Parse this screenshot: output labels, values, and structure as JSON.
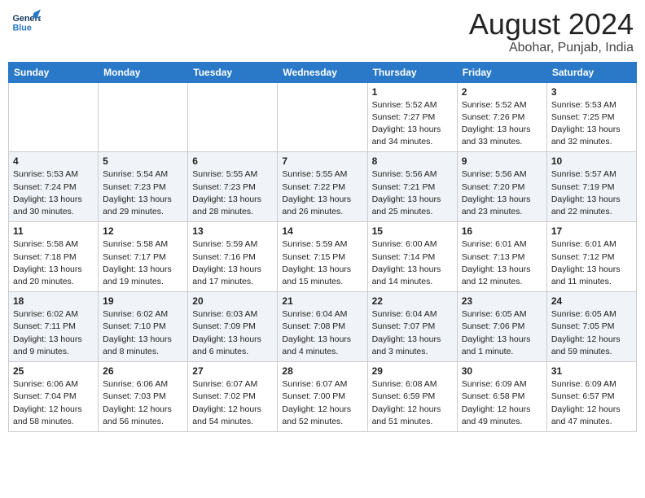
{
  "header": {
    "logo_line1": "General",
    "logo_line2": "Blue",
    "month": "August 2024",
    "location": "Abohar, Punjab, India"
  },
  "days_of_week": [
    "Sunday",
    "Monday",
    "Tuesday",
    "Wednesday",
    "Thursday",
    "Friday",
    "Saturday"
  ],
  "weeks": [
    [
      {
        "day": "",
        "info": ""
      },
      {
        "day": "",
        "info": ""
      },
      {
        "day": "",
        "info": ""
      },
      {
        "day": "",
        "info": ""
      },
      {
        "day": "1",
        "info": "Sunrise: 5:52 AM\nSunset: 7:27 PM\nDaylight: 13 hours\nand 34 minutes."
      },
      {
        "day": "2",
        "info": "Sunrise: 5:52 AM\nSunset: 7:26 PM\nDaylight: 13 hours\nand 33 minutes."
      },
      {
        "day": "3",
        "info": "Sunrise: 5:53 AM\nSunset: 7:25 PM\nDaylight: 13 hours\nand 32 minutes."
      }
    ],
    [
      {
        "day": "4",
        "info": "Sunrise: 5:53 AM\nSunset: 7:24 PM\nDaylight: 13 hours\nand 30 minutes."
      },
      {
        "day": "5",
        "info": "Sunrise: 5:54 AM\nSunset: 7:23 PM\nDaylight: 13 hours\nand 29 minutes."
      },
      {
        "day": "6",
        "info": "Sunrise: 5:55 AM\nSunset: 7:23 PM\nDaylight: 13 hours\nand 28 minutes."
      },
      {
        "day": "7",
        "info": "Sunrise: 5:55 AM\nSunset: 7:22 PM\nDaylight: 13 hours\nand 26 minutes."
      },
      {
        "day": "8",
        "info": "Sunrise: 5:56 AM\nSunset: 7:21 PM\nDaylight: 13 hours\nand 25 minutes."
      },
      {
        "day": "9",
        "info": "Sunrise: 5:56 AM\nSunset: 7:20 PM\nDaylight: 13 hours\nand 23 minutes."
      },
      {
        "day": "10",
        "info": "Sunrise: 5:57 AM\nSunset: 7:19 PM\nDaylight: 13 hours\nand 22 minutes."
      }
    ],
    [
      {
        "day": "11",
        "info": "Sunrise: 5:58 AM\nSunset: 7:18 PM\nDaylight: 13 hours\nand 20 minutes."
      },
      {
        "day": "12",
        "info": "Sunrise: 5:58 AM\nSunset: 7:17 PM\nDaylight: 13 hours\nand 19 minutes."
      },
      {
        "day": "13",
        "info": "Sunrise: 5:59 AM\nSunset: 7:16 PM\nDaylight: 13 hours\nand 17 minutes."
      },
      {
        "day": "14",
        "info": "Sunrise: 5:59 AM\nSunset: 7:15 PM\nDaylight: 13 hours\nand 15 minutes."
      },
      {
        "day": "15",
        "info": "Sunrise: 6:00 AM\nSunset: 7:14 PM\nDaylight: 13 hours\nand 14 minutes."
      },
      {
        "day": "16",
        "info": "Sunrise: 6:01 AM\nSunset: 7:13 PM\nDaylight: 13 hours\nand 12 minutes."
      },
      {
        "day": "17",
        "info": "Sunrise: 6:01 AM\nSunset: 7:12 PM\nDaylight: 13 hours\nand 11 minutes."
      }
    ],
    [
      {
        "day": "18",
        "info": "Sunrise: 6:02 AM\nSunset: 7:11 PM\nDaylight: 13 hours\nand 9 minutes."
      },
      {
        "day": "19",
        "info": "Sunrise: 6:02 AM\nSunset: 7:10 PM\nDaylight: 13 hours\nand 8 minutes."
      },
      {
        "day": "20",
        "info": "Sunrise: 6:03 AM\nSunset: 7:09 PM\nDaylight: 13 hours\nand 6 minutes."
      },
      {
        "day": "21",
        "info": "Sunrise: 6:04 AM\nSunset: 7:08 PM\nDaylight: 13 hours\nand 4 minutes."
      },
      {
        "day": "22",
        "info": "Sunrise: 6:04 AM\nSunset: 7:07 PM\nDaylight: 13 hours\nand 3 minutes."
      },
      {
        "day": "23",
        "info": "Sunrise: 6:05 AM\nSunset: 7:06 PM\nDaylight: 13 hours\nand 1 minute."
      },
      {
        "day": "24",
        "info": "Sunrise: 6:05 AM\nSunset: 7:05 PM\nDaylight: 12 hours\nand 59 minutes."
      }
    ],
    [
      {
        "day": "25",
        "info": "Sunrise: 6:06 AM\nSunset: 7:04 PM\nDaylight: 12 hours\nand 58 minutes."
      },
      {
        "day": "26",
        "info": "Sunrise: 6:06 AM\nSunset: 7:03 PM\nDaylight: 12 hours\nand 56 minutes."
      },
      {
        "day": "27",
        "info": "Sunrise: 6:07 AM\nSunset: 7:02 PM\nDaylight: 12 hours\nand 54 minutes."
      },
      {
        "day": "28",
        "info": "Sunrise: 6:07 AM\nSunset: 7:00 PM\nDaylight: 12 hours\nand 52 minutes."
      },
      {
        "day": "29",
        "info": "Sunrise: 6:08 AM\nSunset: 6:59 PM\nDaylight: 12 hours\nand 51 minutes."
      },
      {
        "day": "30",
        "info": "Sunrise: 6:09 AM\nSunset: 6:58 PM\nDaylight: 12 hours\nand 49 minutes."
      },
      {
        "day": "31",
        "info": "Sunrise: 6:09 AM\nSunset: 6:57 PM\nDaylight: 12 hours\nand 47 minutes."
      }
    ]
  ]
}
